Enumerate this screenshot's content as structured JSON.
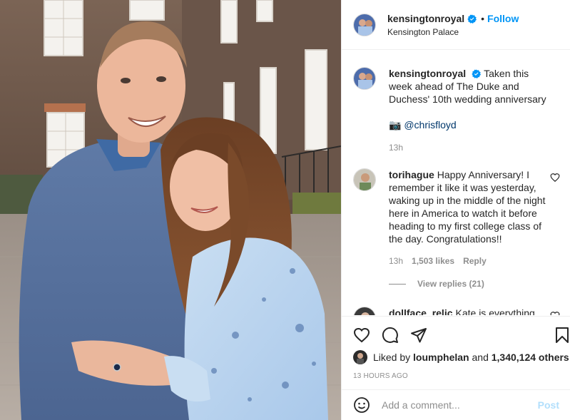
{
  "post": {
    "image_alt": "",
    "header": {
      "username": "kensingtonroyal",
      "dot": "•",
      "follow_label": "Follow",
      "location": "Kensington Palace",
      "avatar_icon": "profile-avatar-icon",
      "verified_icon": "verified-badge-icon"
    },
    "caption": {
      "username": "kensingtonroyal",
      "text": "Taken this week ahead of The Duke and Duchess' 10th wedding anniversary",
      "credit_icon": "📷",
      "credit": "@chrisfloyd",
      "time": "13h"
    },
    "comments": [
      {
        "username": "torihague",
        "text": "Happy Anniversary! I remember it like it was yesterday, waking up in the middle of the night here in America to watch it before heading to my first college class of the day. Congratulations!!",
        "time": "13h",
        "likes": "1,503 likes",
        "reply_label": "Reply",
        "view_replies": "View replies (21)"
      },
      {
        "username": "dollface_relic",
        "text": "Kate is everything"
      }
    ],
    "actions": {
      "icons": [
        "heart-icon",
        "comment-icon",
        "share-icon",
        "bookmark-icon"
      ]
    },
    "likes": {
      "prefix": "Liked by",
      "user": "loumphelan",
      "connector": "and",
      "count": "1,340,124 others"
    },
    "timestamp": "13 HOURS AGO",
    "add_comment": {
      "placeholder": "Add a comment...",
      "post_label": "Post",
      "emoji_icon": "emoji-icon"
    }
  },
  "colors": {
    "accent": "#0095f6",
    "link": "#00376b",
    "secondary_text": "#8e8e8e",
    "post_disabled": "#b2dffc",
    "divider": "#efefef"
  }
}
